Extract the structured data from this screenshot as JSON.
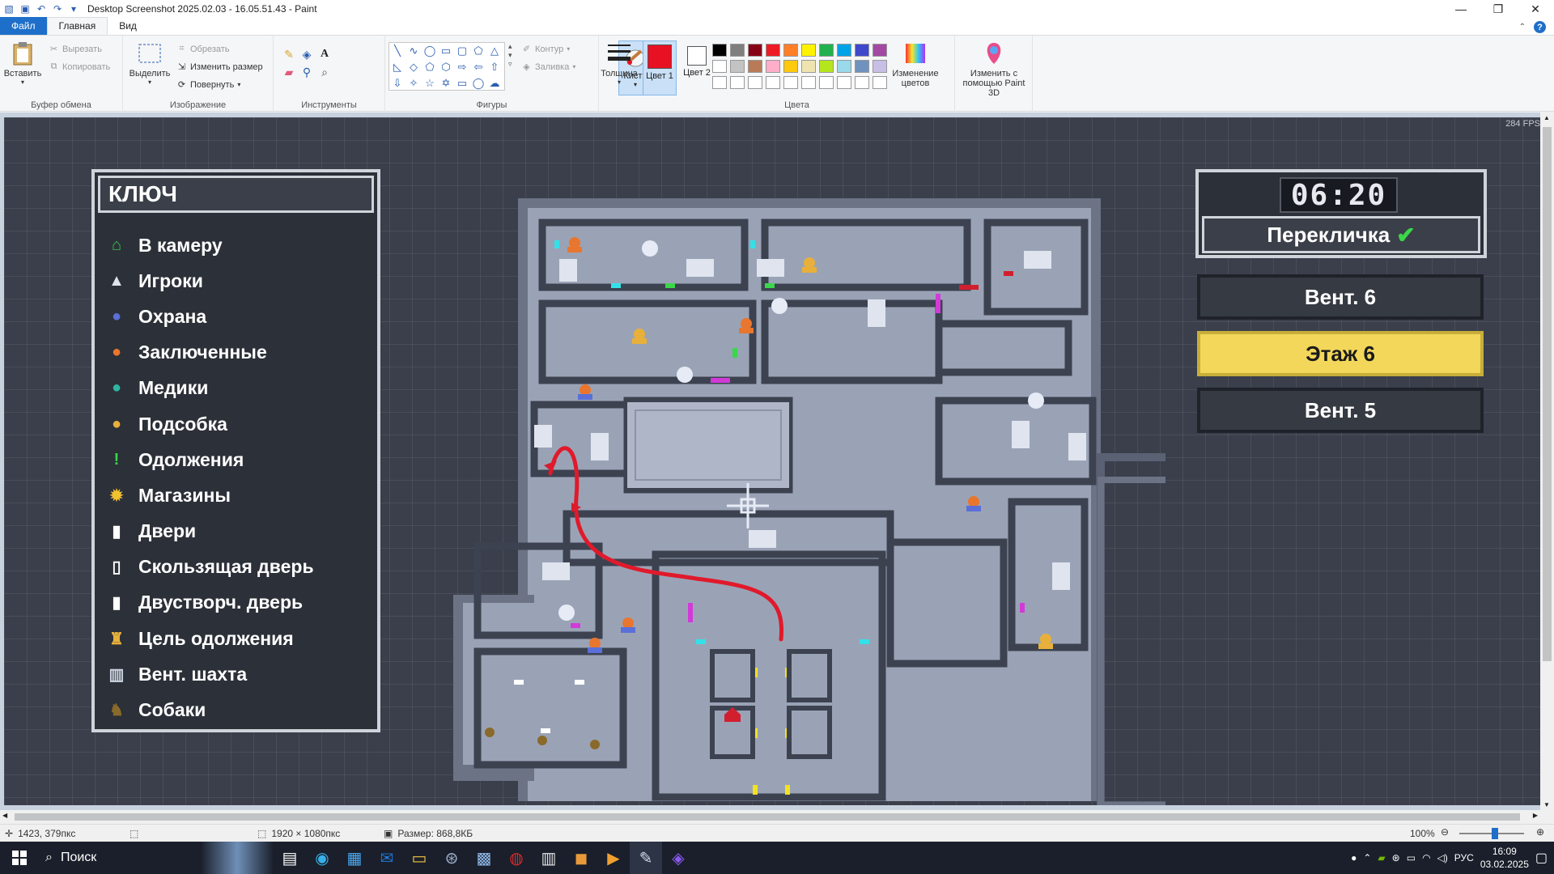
{
  "window": {
    "title": "Desktop Screenshot 2025.02.03 - 16.05.51.43 - Paint"
  },
  "ribbon": {
    "tabs": [
      {
        "label": "Файл"
      },
      {
        "label": "Главная"
      },
      {
        "label": "Вид"
      }
    ],
    "clipboard": {
      "paste": "Вставить",
      "cut": "Вырезать",
      "copy": "Копировать",
      "group": "Буфер обмена"
    },
    "image": {
      "select": "Выделить",
      "crop": "Обрезать",
      "resize": "Изменить размер",
      "rotate": "Повернуть",
      "group": "Изображение"
    },
    "tools": {
      "group": "Инструменты",
      "brushes": "Кисти"
    },
    "shapes": {
      "group": "Фигуры",
      "outline": "Контур",
      "fill": "Заливка"
    },
    "size": {
      "label": "Толщина"
    },
    "colors": {
      "color1": "Цвет 1",
      "color2": "Цвет 2",
      "edit": "Изменение цветов",
      "group": "Цвета",
      "color1_value": "#e81123",
      "color2_value": "#ffffff",
      "palette": [
        "#000000",
        "#7f7f7f",
        "#880015",
        "#ed1c24",
        "#ff7f27",
        "#fff200",
        "#22b14c",
        "#00a2e8",
        "#3f48cc",
        "#a349a4",
        "#ffffff",
        "#c3c3c3",
        "#b97a57",
        "#ffaec9",
        "#ffc90e",
        "#efe4b0",
        "#b5e61d",
        "#99d9ea",
        "#7092be",
        "#c8bfe7",
        "#ffffff",
        "#ffffff",
        "#ffffff",
        "#ffffff",
        "#ffffff",
        "#ffffff",
        "#ffffff",
        "#ffffff",
        "#ffffff",
        "#ffffff"
      ]
    },
    "paint3d": {
      "label": "Изменить с помощью Paint 3D"
    }
  },
  "image": {
    "fps": "284 FPS",
    "key": {
      "title": "КЛЮЧ",
      "items": [
        {
          "label": "В камеру",
          "icon": "home-icon",
          "color": "#36c94a"
        },
        {
          "label": "Игроки",
          "icon": "player-arrow-icon",
          "color": "#e0e3ea"
        },
        {
          "label": "Охрана",
          "icon": "guard-icon",
          "color": "#5a6fd8"
        },
        {
          "label": "Заключенные",
          "icon": "inmate-icon",
          "color": "#e8762e"
        },
        {
          "label": "Медики",
          "icon": "medic-icon",
          "color": "#2fb4a3"
        },
        {
          "label": "Подсобка",
          "icon": "staff-icon",
          "color": "#e8b03a"
        },
        {
          "label": "Одолжения",
          "icon": "favour-icon",
          "color": "#3bd64a"
        },
        {
          "label": "Магазины",
          "icon": "shop-icon",
          "color": "#f2c232"
        },
        {
          "label": "Двери",
          "icon": "door-icon",
          "color": "#ffffff"
        },
        {
          "label": "Скользящая дверь",
          "icon": "sliding-door-icon",
          "color": "#ffffff"
        },
        {
          "label": "Двустворч. дверь",
          "icon": "double-door-icon",
          "color": "#ffffff"
        },
        {
          "label": "Цель одолжения",
          "icon": "favour-target-icon",
          "color": "#e8b03a"
        },
        {
          "label": "Вент. шахта",
          "icon": "vent-icon",
          "color": "#cfd6e4"
        },
        {
          "label": "Собаки",
          "icon": "dog-icon",
          "color": "#8a6a2a"
        }
      ]
    },
    "hud": {
      "timer": "06:20",
      "roll_call": "Перекличка",
      "floors": [
        {
          "label": "Вент. 6",
          "selected": false
        },
        {
          "label": "Этаж 6",
          "selected": true
        },
        {
          "label": "Вент. 5",
          "selected": false
        }
      ]
    }
  },
  "status": {
    "cursor_pos": "1423, 379пкс",
    "selection": "",
    "image_size": "1920 × 1080пкс",
    "file_size": "Размер: 868,8КБ",
    "zoom": "100%"
  },
  "taskbar": {
    "search": "Поиск",
    "lang": "РУС",
    "time": "16:09",
    "date": "03.02.2025"
  }
}
